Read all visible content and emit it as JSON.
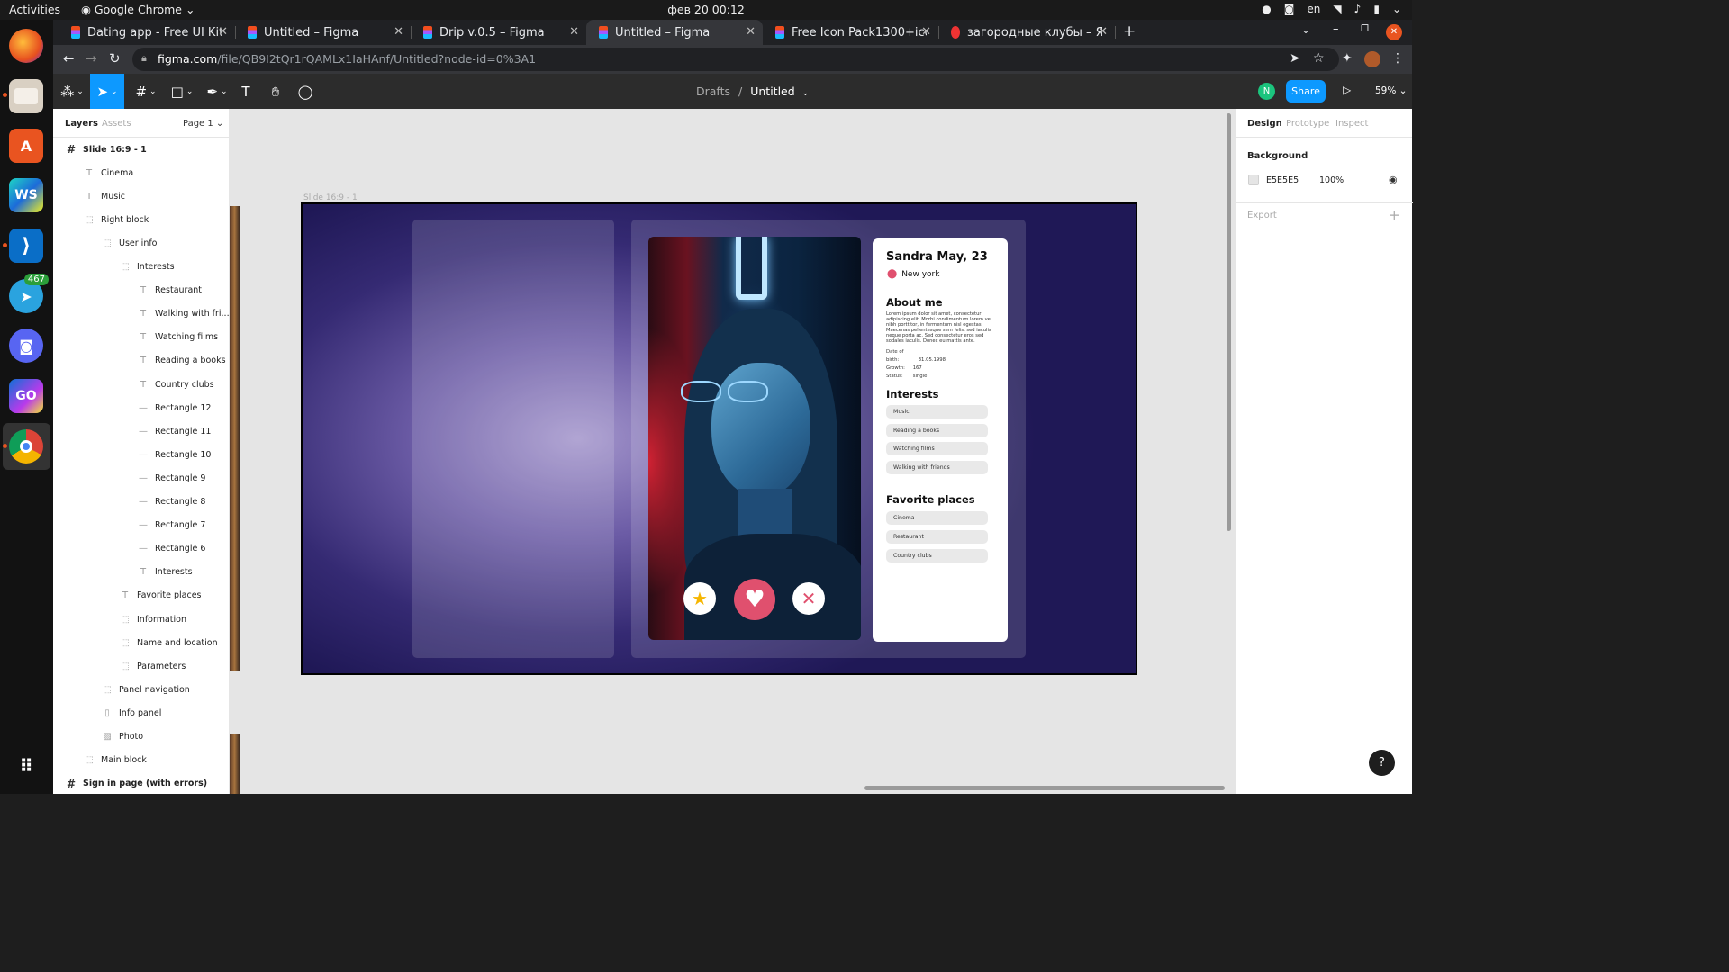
{
  "system": {
    "activities": "Activities",
    "app_name": "Google Chrome",
    "clock": "фев 20  00:12",
    "lang": "en"
  },
  "dock": {
    "items": [
      {
        "name": "firefox",
        "label": ""
      },
      {
        "name": "files",
        "label": ""
      },
      {
        "name": "app-center",
        "label": "A"
      },
      {
        "name": "webstorm",
        "label": "WS"
      },
      {
        "name": "vscode",
        "label": ""
      },
      {
        "name": "telegram",
        "label": "",
        "badge": "467"
      },
      {
        "name": "discord",
        "label": ""
      },
      {
        "name": "goland",
        "label": "GO"
      },
      {
        "name": "chrome",
        "label": ""
      }
    ]
  },
  "browser": {
    "tabs": [
      {
        "label": "Dating app - Free UI Kit – F",
        "active": false
      },
      {
        "label": "Untitled – Figma",
        "active": false
      },
      {
        "label": "Drip v.0.5 – Figma",
        "active": false
      },
      {
        "label": "Untitled – Figma",
        "active": true
      },
      {
        "label": "Free Icon Pack1300+icons",
        "active": false
      },
      {
        "label": "загородные клубы – Янд",
        "active": false
      }
    ],
    "new_tab": "+",
    "url_host": "figma.com",
    "url_path": "/file/QB9I2tQr1rQAMLx1IaHAnf/Untitled?node-id=0%3A1"
  },
  "figma": {
    "breadcrumb_parent": "Drafts",
    "breadcrumb_sep": "/",
    "file_name": "Untitled",
    "avatar_initial": "N",
    "share_label": "Share",
    "zoom": "59%"
  },
  "layers_panel": {
    "tab_layers": "Layers",
    "tab_assets": "Assets",
    "page": "Page 1",
    "rows": [
      {
        "label": "Slide 16:9 - 1",
        "icon": "frame",
        "indent": 0,
        "bold": true
      },
      {
        "label": "Cinema",
        "icon": "text",
        "indent": 1
      },
      {
        "label": "Music",
        "icon": "text",
        "indent": 1
      },
      {
        "label": "Right block",
        "icon": "group",
        "indent": 1
      },
      {
        "label": "User info",
        "icon": "group",
        "indent": 2
      },
      {
        "label": "Interests",
        "icon": "group",
        "indent": 3
      },
      {
        "label": "Restaurant",
        "icon": "text",
        "indent": 4
      },
      {
        "label": "Walking with fri...",
        "icon": "text",
        "indent": 4
      },
      {
        "label": "Watching films",
        "icon": "text",
        "indent": 4
      },
      {
        "label": "Reading a books",
        "icon": "text",
        "indent": 4
      },
      {
        "label": "Country clubs",
        "icon": "text",
        "indent": 4
      },
      {
        "label": "Rectangle 12",
        "icon": "rect",
        "indent": 4
      },
      {
        "label": "Rectangle 11",
        "icon": "rect",
        "indent": 4
      },
      {
        "label": "Rectangle 10",
        "icon": "rect",
        "indent": 4
      },
      {
        "label": "Rectangle 9",
        "icon": "rect",
        "indent": 4
      },
      {
        "label": "Rectangle 8",
        "icon": "rect",
        "indent": 4
      },
      {
        "label": "Rectangle 7",
        "icon": "rect",
        "indent": 4
      },
      {
        "label": "Rectangle 6",
        "icon": "rect",
        "indent": 4
      },
      {
        "label": "Interests",
        "icon": "text",
        "indent": 4
      },
      {
        "label": "Favorite places",
        "icon": "text",
        "indent": 3
      },
      {
        "label": "Information",
        "icon": "group",
        "indent": 3
      },
      {
        "label": "Name and location",
        "icon": "group",
        "indent": 3
      },
      {
        "label": "Parameters",
        "icon": "group",
        "indent": 3
      },
      {
        "label": "Panel navigation",
        "icon": "group",
        "indent": 2
      },
      {
        "label": "Info panel",
        "icon": "rect-v",
        "indent": 2
      },
      {
        "label": "Photo",
        "icon": "image",
        "indent": 2
      },
      {
        "label": "Main block",
        "icon": "group",
        "indent": 1
      },
      {
        "label": "Sign in page (with errors)",
        "icon": "frame",
        "indent": 0,
        "bold": true
      }
    ]
  },
  "canvas": {
    "frame_label": "Slide 16:9 - 1",
    "profile": {
      "name": "Sandra May, 23",
      "location": "New york",
      "about_title": "About me",
      "about_text": "Lorem ipsum dolor sit amet, consectetur adipiscing elit. Morbi condimentum lorem vel nibh porttitor, in fermentum nisl egestas. Maecenas pellentesque sem felis, sed iaculis neque porta ac. Sed consectetur eros sed sodales iaculis. Donec eu mattis ante.",
      "params": [
        {
          "key": "Date of birth:",
          "value": "31.05.1998"
        },
        {
          "key": "Growth:",
          "value": "167"
        },
        {
          "key": "Status:",
          "value": "single"
        }
      ],
      "interests_title": "Interests",
      "interests": [
        "Music",
        "Reading a books",
        "Watching films",
        "Walking with friends"
      ],
      "places_title": "Favorite places",
      "places": [
        "Cinema",
        "Restaurant",
        "Country clubs"
      ]
    }
  },
  "design_panel": {
    "tabs": [
      "Design",
      "Prototype",
      "Inspect"
    ],
    "background_title": "Background",
    "bg_hex": "E5E5E5",
    "bg_opacity": "100%",
    "export_label": "Export",
    "help": "?"
  },
  "colors": {
    "figma_blue": "#0d99ff",
    "heart_pink": "#e0506e",
    "star_yellow": "#f6b600",
    "canvas_bg": "#e5e5e5"
  }
}
